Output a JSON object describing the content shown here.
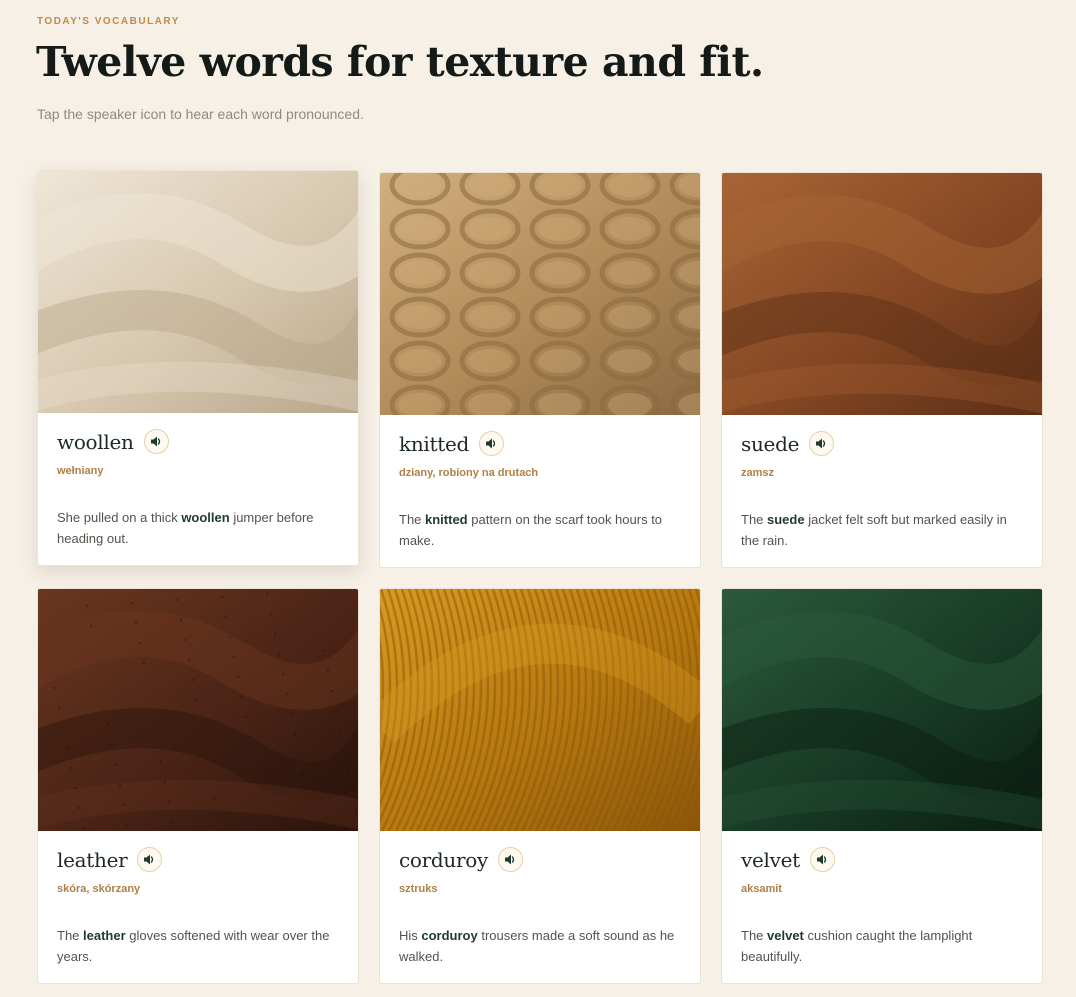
{
  "header": {
    "eyebrow": "TODAY'S VOCABULARY",
    "title": "Twelve words for texture and fit.",
    "subtitle": "Tap the speaker icon to hear each word pronounced."
  },
  "cards": [
    {
      "word": "woollen",
      "translation": "wełniany",
      "sentence_before": "She pulled on a thick ",
      "sentence_word": "woollen",
      "sentence_after": " jumper before heading out.",
      "speaker_icon": "speaker-icon",
      "texture": "cream-wool",
      "colors": [
        "#efe6d7",
        "#d7c7ae",
        "#b8a68a"
      ]
    },
    {
      "word": "knitted",
      "translation": "dziany, robiony na drutach",
      "sentence_before": "The ",
      "sentence_word": "knitted",
      "sentence_after": " pattern on the scarf took hours to make.",
      "speaker_icon": "speaker-icon",
      "texture": "cable-knit",
      "colors": [
        "#d2b07e",
        "#b08a58",
        "#8a6a42"
      ]
    },
    {
      "word": "suede",
      "translation": "zamsz",
      "sentence_before": "The ",
      "sentence_word": "suede",
      "sentence_after": " jacket felt soft but marked easily in the rain.",
      "speaker_icon": "speaker-icon",
      "texture": "brown-suede",
      "colors": [
        "#a86536",
        "#844723",
        "#5c2e16"
      ]
    },
    {
      "word": "leather",
      "translation": "skóra, skórzany",
      "sentence_before": "The ",
      "sentence_word": "leather",
      "sentence_after": " gloves softened with wear over the years.",
      "speaker_icon": "speaker-icon",
      "texture": "dark-leather",
      "colors": [
        "#6a3620",
        "#4a2416",
        "#2a130b"
      ]
    },
    {
      "word": "corduroy",
      "translation": "sztruks",
      "sentence_before": "His ",
      "sentence_word": "corduroy",
      "sentence_after": " trousers made a soft sound as he walked.",
      "speaker_icon": "speaker-icon",
      "texture": "mustard-corduroy",
      "colors": [
        "#d99a22",
        "#b6780f",
        "#8a560a"
      ]
    },
    {
      "word": "velvet",
      "translation": "aksamit",
      "sentence_before": "The ",
      "sentence_word": "velvet",
      "sentence_after": " cushion caught the lamplight beautifully.",
      "speaker_icon": "speaker-icon",
      "texture": "green-velvet",
      "colors": [
        "#2c5a3a",
        "#183a26",
        "#0a1d12"
      ]
    }
  ]
}
